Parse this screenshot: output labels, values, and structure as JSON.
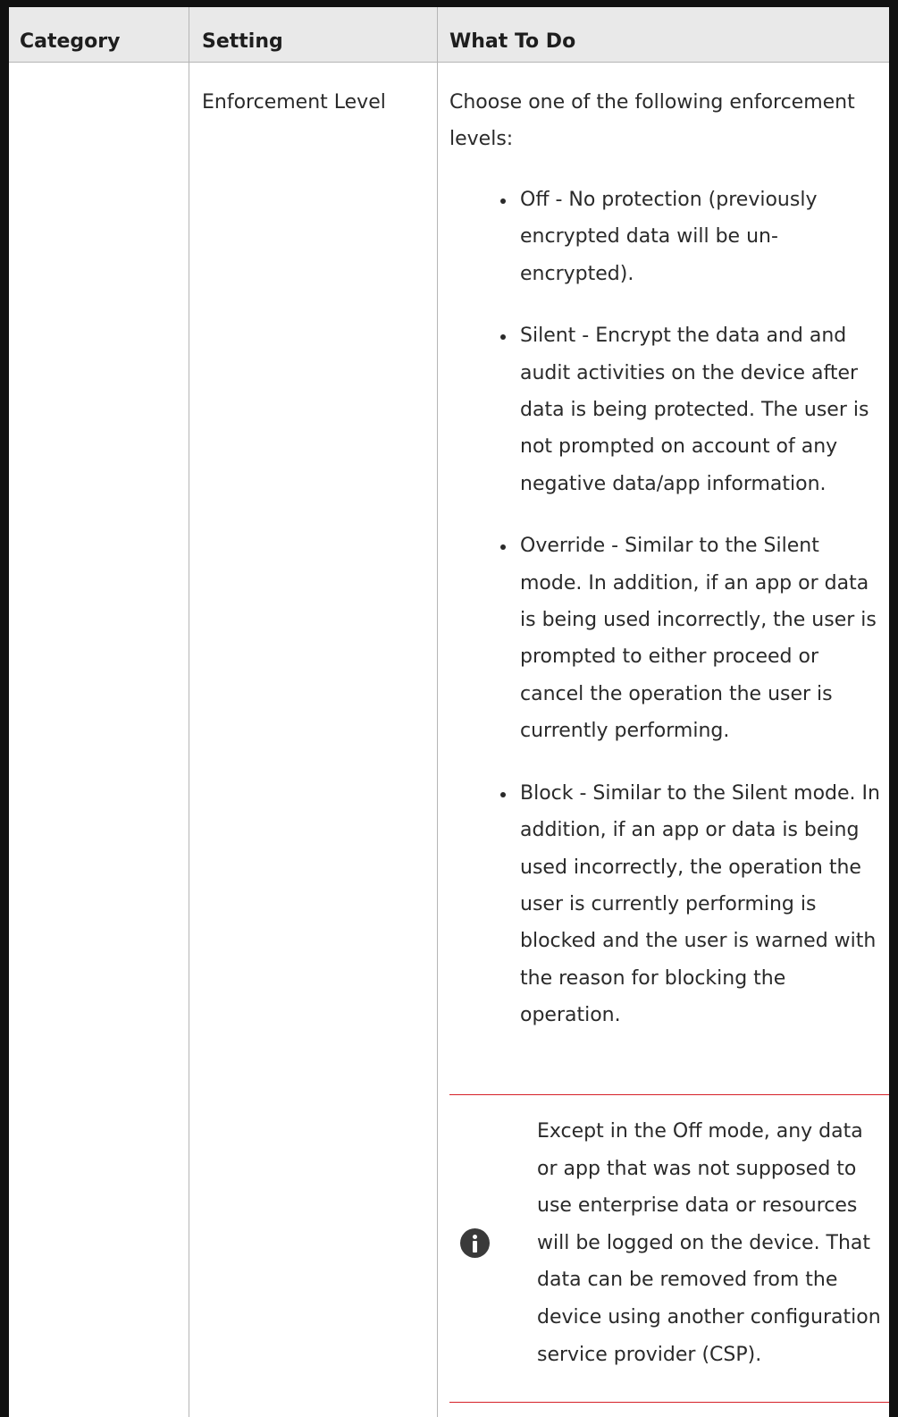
{
  "table": {
    "headers": {
      "category": "Category",
      "setting": "Setting",
      "what_to_do": "What To Do"
    },
    "row": {
      "category": "",
      "setting": "Enforcement Level",
      "intro": "Choose one of the following enforcement levels:",
      "levels": [
        "Off - No protection (previously encrypted data will be un-encrypted).",
        "Silent - Encrypt the data and and audit activities on the device after data is being protected. The user is not prompted on account of any negative data/app information.",
        "Override - Similar to the Silent mode. In addition, if an app or data is being used incorrectly, the user is prompted to either proceed or cancel the operation the user is currently performing.",
        "Block - Similar to the Silent mode. In addition, if an app or data is being used incorrectly, the operation the user is currently performing is blocked and the user is warned with the reason for blocking the operation."
      ],
      "note": {
        "icon": "info-icon",
        "accent_color": "#d62128",
        "text": "Except in the Off mode, any data or app that was not supposed to use enterprise data or resources will be logged on the device. That data can be removed from the device using another configuration service provider (CSP)."
      }
    }
  }
}
